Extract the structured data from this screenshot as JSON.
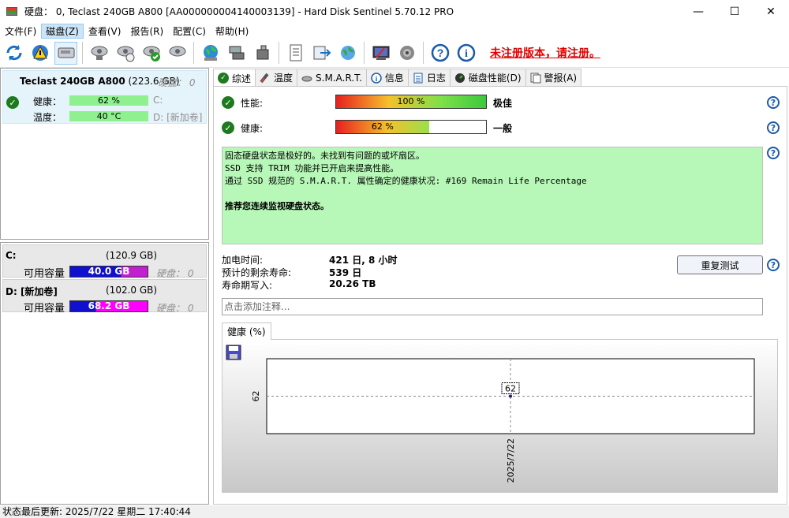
{
  "window": {
    "title": "硬盘：  0, Teclast 240GB A800 [AA000000004140003139]  -  Hard Disk Sentinel 5.70.12 PRO",
    "minimize": "—",
    "maximize": "☐",
    "close": "✕"
  },
  "menu": [
    "文件(F)",
    "磁盘(Z)",
    "查看(V)",
    "报告(R)",
    "配置(C)",
    "帮助(H)"
  ],
  "toolbar": {
    "unregistered": "未注册版本，请注册。"
  },
  "disk": {
    "name": "Teclast 240GB A800",
    "size": "(223.6 GB)",
    "hd_label": "硬盘：",
    "hd_index": "0",
    "health_label": "健康：",
    "health_value": "62 %",
    "temp_label": "温度：",
    "temp_value": "40 °C",
    "drive_c": "C:",
    "drive_d": "D: [新加卷]"
  },
  "volumes": [
    {
      "name": "C:",
      "size": "(120.9 GB)",
      "free_label": "可用容量",
      "free": "40.0 GB",
      "hd": "硬盘：  0",
      "color": "#a020f0"
    },
    {
      "name": "D: [新加卷]",
      "size": "(102.0 GB)",
      "free_label": "可用容量",
      "free": "68.2 GB",
      "hd": "硬盘：  0",
      "color": "#ff00ff"
    }
  ],
  "tabs": [
    "综述",
    "温度",
    "S.M.A.R.T.",
    "信息",
    "日志",
    "磁盘性能(D)",
    "警报(A)"
  ],
  "overview": {
    "performance_label": "性能:",
    "performance_value": "100 %",
    "performance_pct": 100,
    "performance_rating": "极佳",
    "health_label": "健康:",
    "health_value": "62 %",
    "health_pct": 62,
    "health_rating": "一般",
    "status_lines": [
      "固态硬盘状态是极好的。未找到有问题的或坏扇区。",
      "SSD 支持 TRIM 功能并已开启来提高性能。",
      "通过 SSD 规范的 S.M.A.R.T. 属性确定的健康状况:   #169 Remain Life Percentage"
    ],
    "recommendation": "推荐您连续监视硬盘状态。",
    "power_on_label": "加电时间:",
    "power_on_value": "421 日, 8 小时",
    "remaining_label": "预计的剩余寿命:",
    "remaining_value": "539 日",
    "written_label": "寿命期写入:",
    "written_value": "20.26 TB",
    "retest_button": "重复测试",
    "note_placeholder": "点击添加注释..."
  },
  "chart_data": {
    "type": "line",
    "tab_label": "健康 (%)",
    "x": [
      "2025/7/22"
    ],
    "series": [
      {
        "values": [
          62
        ]
      }
    ],
    "yticks": [
      "62"
    ],
    "data_label": "62",
    "title": "",
    "xlabel": "",
    "ylabel": ""
  },
  "statusbar": "状态最后更新:   2025/7/22 星期二 17:40:44"
}
